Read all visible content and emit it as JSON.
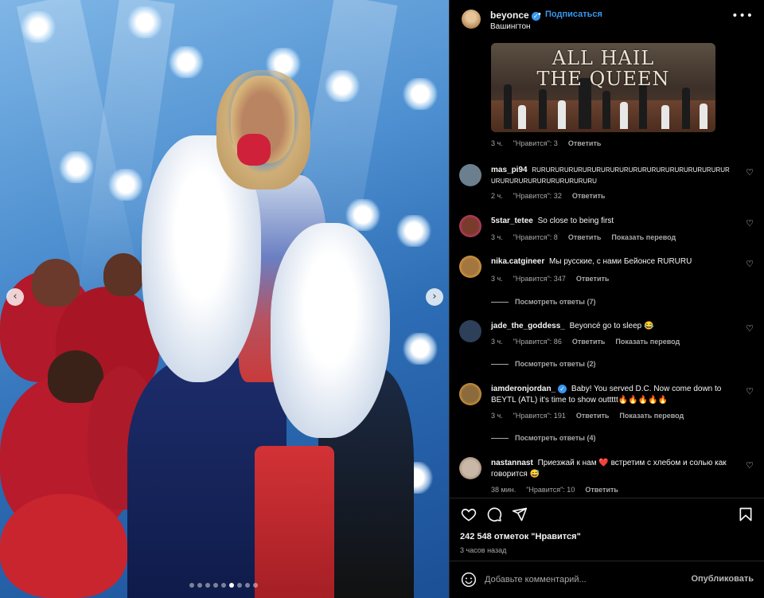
{
  "post": {
    "username": "beyonce",
    "verified_icon": "verified-badge-icon",
    "separator": "•",
    "follow_label": "Подписаться",
    "location": "Вашингтон",
    "more_icon": "more-options-icon"
  },
  "media": {
    "prev_icon": "chevron-left-icon",
    "next_icon": "chevron-right-icon",
    "slide_count": 9,
    "active_slide": 5
  },
  "gif_comment": {
    "gif_text_line1": "ALL HAIL",
    "gif_text_line2": "THE QUEEN",
    "time": "3 ч.",
    "likes": "\"Нравится\": 3",
    "reply": "Ответить"
  },
  "comments": [
    {
      "username": "mas_pi94",
      "text": "RURURURURURURURURURURURURURURURURURURURURURURURURURURURURURURURURU",
      "time": "2 ч.",
      "likes": "\"Нравится\": 32",
      "reply": "Ответить",
      "avatar_color": "#6b7f8f"
    },
    {
      "username": "5star_tetee",
      "text": "So close to being first",
      "time": "3 ч.",
      "likes": "\"Нравится\": 8",
      "reply": "Ответить",
      "translate": "Показать перевод",
      "avatar_color": "#7a3b2c"
    },
    {
      "username": "nika.catgineer",
      "text": "Мы русские, с нами Бейонсе RURURU",
      "time": "3 ч.",
      "likes": "\"Нравится\": 347",
      "reply": "Ответить",
      "avatar_color": "#a4763f",
      "replies": "Посмотреть ответы (7)"
    },
    {
      "username": "jade_the_goddess_",
      "text": "Beyoncé go to sleep 😂",
      "time": "3 ч.",
      "likes": "\"Нравится\": 86",
      "reply": "Ответить",
      "translate": "Показать перевод",
      "avatar_color": "#2e3f5a",
      "replies": "Посмотреть ответы (2)"
    },
    {
      "username": "iamderonjordan_",
      "text": "Baby! You served D.C. Now come down to BEYTL (ATL) it's time to show outtttt🔥🔥🔥🔥🔥",
      "time": "3 ч.",
      "likes": "\"Нравится\": 191",
      "reply": "Ответить",
      "translate": "Показать перевод",
      "avatar_color": "#8b6a3c",
      "replies": "Посмотреть ответы (4)"
    },
    {
      "username": "nastannast",
      "text": "Приезжай к нам ❤️ встретим с хлебом и солью как говорится 😅",
      "time": "38 мин.",
      "likes": "\"Нравится\": 10",
      "reply": "Ответить",
      "avatar_color": "#c9b8a8"
    }
  ],
  "actions": {
    "like_icon": "heart-icon",
    "comment_icon": "comment-icon",
    "share_icon": "share-icon",
    "save_icon": "bookmark-icon"
  },
  "likes_total": "242 548 отметок \"Нравится\"",
  "posted_ago": "3 часов назад",
  "comment_box": {
    "emoji_icon": "emoji-icon",
    "placeholder": "Добавьте комментарий...",
    "publish_label": "Опубликовать"
  },
  "colors": {
    "background": "#000000",
    "text": "#f5f5f5",
    "muted": "#a8a8a8",
    "accent": "#3897f0",
    "heart_red": "#ff3040"
  }
}
